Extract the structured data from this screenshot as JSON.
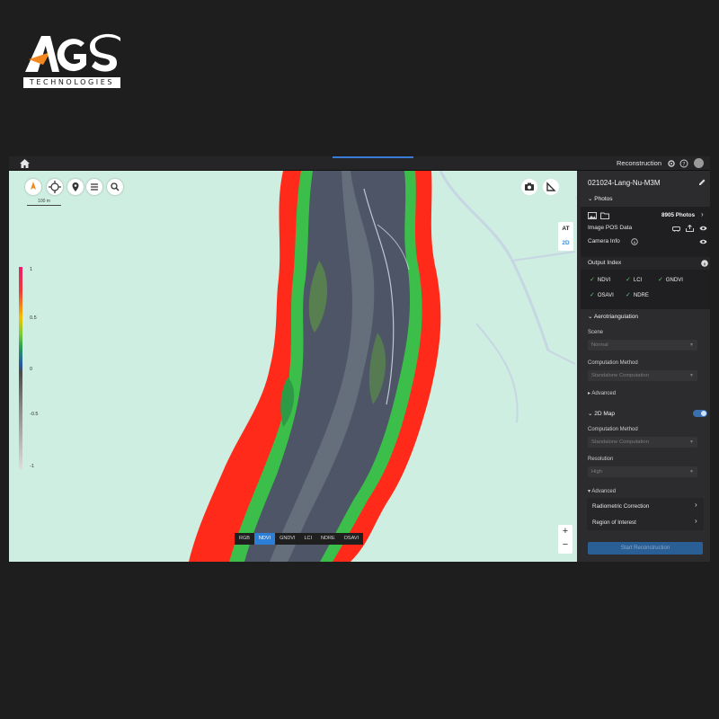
{
  "logo": {
    "word": "AGS",
    "sub": "TECHNOLOGIES"
  },
  "topbar": {
    "title": "Reconstruction"
  },
  "map": {
    "scale_label": "100 m",
    "view_switch": {
      "at": "AT",
      "two_d": "2D"
    },
    "zoom_in": "+",
    "zoom_out": "−",
    "collapse": "»",
    "legend_ticks": [
      "1",
      "0.5",
      "0",
      "-0.5",
      "-1"
    ],
    "index_buttons": [
      "RGB",
      "NDVI",
      "GNDVI",
      "LCI",
      "NDRE",
      "OSAVI"
    ],
    "active_index": "NDVI"
  },
  "panel": {
    "project_title": "021024-Lang-Nu-M3M",
    "photos": {
      "header": "Photos",
      "count": "8905 Photos",
      "pos_label": "Image POS Data",
      "camera_label": "Camera Info"
    },
    "output_index": {
      "header": "Output Index",
      "items": [
        "NDVI",
        "LCI",
        "GNDVI",
        "OSAVI",
        "NDRE"
      ]
    },
    "aerotriangulation": {
      "header": "Aerotriangulation",
      "scene_label": "Scene",
      "scene_value": "Normal",
      "method_label": "Computation Method",
      "method_value": "Standalone Computation",
      "advanced": "Advanced"
    },
    "map2d": {
      "header": "2D Map",
      "method_label": "Computation Method",
      "method_value": "Standalone Computation",
      "resolution_label": "Resolution",
      "resolution_value": "High",
      "advanced": "Advanced",
      "adv_items": [
        "Radiometric Correction",
        "Region of Interest"
      ]
    },
    "start_button": "Start Reconstruction"
  },
  "colors": {
    "accent": "#2b7fd6",
    "check": "#4cd06a",
    "map_bg": "#cdeee0",
    "ndvi_red": "#ff2a1a"
  }
}
